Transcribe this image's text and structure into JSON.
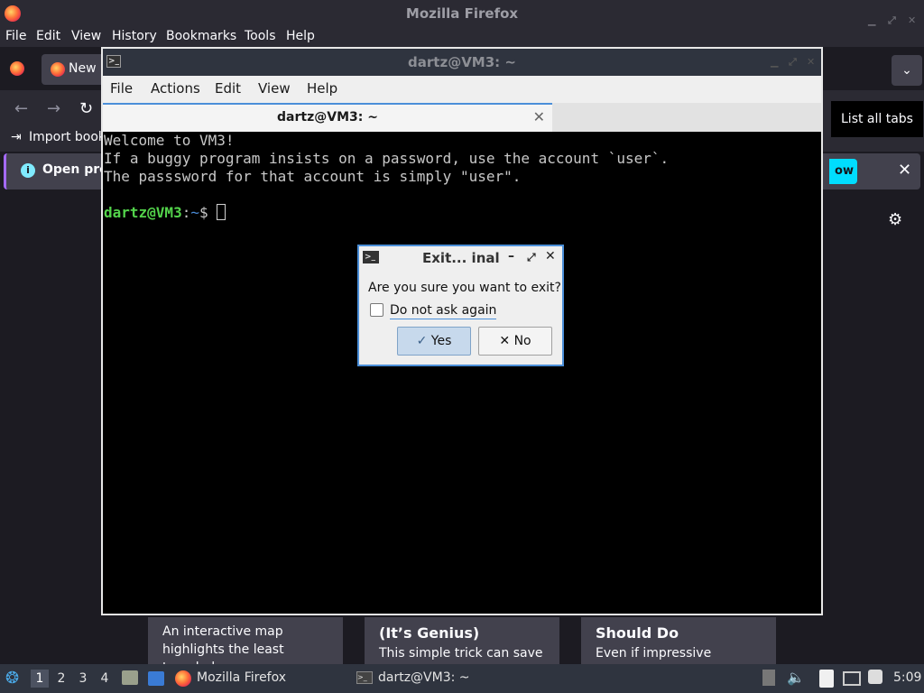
{
  "firefox": {
    "title": "Mozilla Firefox",
    "menu": [
      "File",
      "Edit",
      "View",
      "History",
      "Bookmarks",
      "Tools",
      "Help"
    ],
    "tab_label": "New",
    "bookmark_label": "Import book",
    "notice_text": "Open pre",
    "notice_button": "ow",
    "tooltip": "List all tabs"
  },
  "cards": [
    {
      "title": "",
      "text": "An interactive map highlights the least traveled"
    },
    {
      "title": "(It’s Genius)",
      "text": "This simple trick can save"
    },
    {
      "title": "Should Do",
      "text": "Even if impressive"
    }
  ],
  "terminal": {
    "title": "dartz@VM3: ~",
    "menu": [
      "File",
      "Actions",
      "Edit",
      "View",
      "Help"
    ],
    "tab_label": "dartz@VM3: ~",
    "lines": [
      "Welcome to VM3!",
      "If a buggy program insists on a password, use the account `user`.",
      "The passsword for that account is simply \"user\"."
    ],
    "prompt_user": "dartz@VM3",
    "prompt_colon": ":",
    "prompt_path": "~",
    "prompt_symbol": "$"
  },
  "dialog": {
    "title": "Exit... inal",
    "question": "Are you sure you want to exit?",
    "checkbox_label": "Do not ask again",
    "yes_label": "Yes",
    "no_label": "No"
  },
  "taskbar": {
    "workspaces": [
      "1",
      "2",
      "3",
      "4"
    ],
    "firefox_label": "Mozilla Firefox",
    "terminal_label": "dartz@VM3: ~",
    "clock": "5:09"
  }
}
